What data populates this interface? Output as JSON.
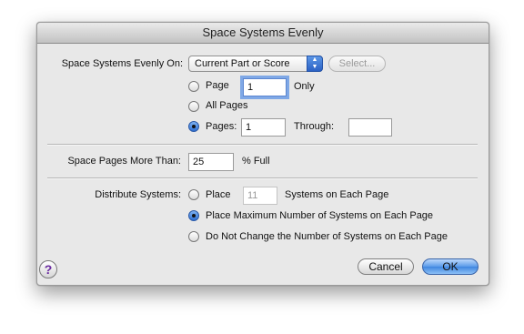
{
  "window": {
    "title": "Space Systems Evenly"
  },
  "space_on": {
    "label": "Space Systems Evenly On:",
    "popup_value": "Current Part or Score",
    "select_button": "Select...",
    "page_option": {
      "label": "Page",
      "value": "1",
      "suffix": "Only",
      "selected": false
    },
    "all_pages_option": {
      "label": "All Pages",
      "selected": false
    },
    "pages_option": {
      "label": "Pages:",
      "from": "1",
      "through_label": "Through:",
      "through": "",
      "selected": true
    }
  },
  "space_pages": {
    "label": "Space Pages More Than:",
    "value": "25",
    "suffix": "% Full"
  },
  "distribute": {
    "label": "Distribute Systems:",
    "place_option": {
      "label": "Place",
      "value": "11",
      "suffix": "Systems on Each Page",
      "selected": false
    },
    "max_option": {
      "label": "Place Maximum Number of Systems on Each Page",
      "selected": true
    },
    "no_change_option": {
      "label": "Do Not Change the Number of Systems on Each Page",
      "selected": false
    }
  },
  "footer": {
    "help": "?",
    "cancel": "Cancel",
    "ok": "OK"
  }
}
